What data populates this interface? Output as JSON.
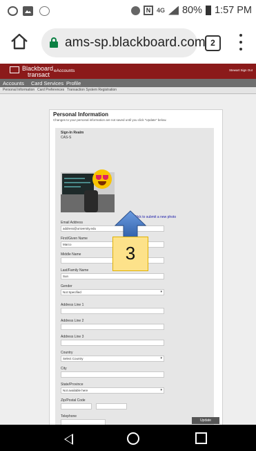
{
  "status_bar": {
    "battery": "80%",
    "time": "1:57 PM",
    "network": "4G LTE",
    "icons": [
      "globe-icon",
      "gallery-icon",
      "circle-icon",
      "bluetooth-icon",
      "nfc-icon",
      "signal-icon",
      "battery-icon"
    ]
  },
  "browser": {
    "url": "ams-sp.blackboard.com",
    "tab_count": "2"
  },
  "site": {
    "logo_line1": "Blackboard",
    "logo_line2": "transact",
    "app_name": "eAccounts",
    "header_right": "Stewart    Sign Out",
    "nav": [
      "Accounts",
      "Card Services",
      "Profile"
    ],
    "subnav": [
      "Personal Information",
      "Card Preferences",
      "Transaction System Registration"
    ]
  },
  "panel": {
    "title": "Personal Information",
    "subtitle": "Changes to your personal information are not saved until you click \"Update\" below.",
    "sign_in_realm_label": "Sign-In Realm",
    "sign_in_realm_value": "CAS-S",
    "submit_photo_link": "Click to submit a new photo",
    "fields": [
      {
        "label": "Email Address",
        "value": "address@university.edu"
      },
      {
        "label": "First/Given Name",
        "value": "Marco"
      },
      {
        "label": "Middle Name",
        "value": ""
      },
      {
        "label": "Last/Family Name",
        "value": "Sun"
      },
      {
        "label": "Gender",
        "value": "Not Specified",
        "select": true
      },
      {
        "label": "Address Line 1",
        "value": ""
      },
      {
        "label": "Address Line 2",
        "value": ""
      },
      {
        "label": "Address Line 3",
        "value": ""
      },
      {
        "label": "Country",
        "value": "Select Country",
        "select": true
      },
      {
        "label": "City",
        "value": ""
      },
      {
        "label": "State/Province",
        "value": "Not available here",
        "select": true
      },
      {
        "label": "Zip/Postal Code",
        "value": ""
      },
      {
        "label": "Telephone",
        "value": ""
      }
    ],
    "update_button": "Update"
  },
  "annotation": {
    "callout_number": "3",
    "callout_color": "#fde28a",
    "arrow_color": "#4a7cc4"
  },
  "colors": {
    "header_red": "#8b1a1a",
    "nav_gray": "#6e6e6e",
    "lock_green": "#0b8043"
  }
}
